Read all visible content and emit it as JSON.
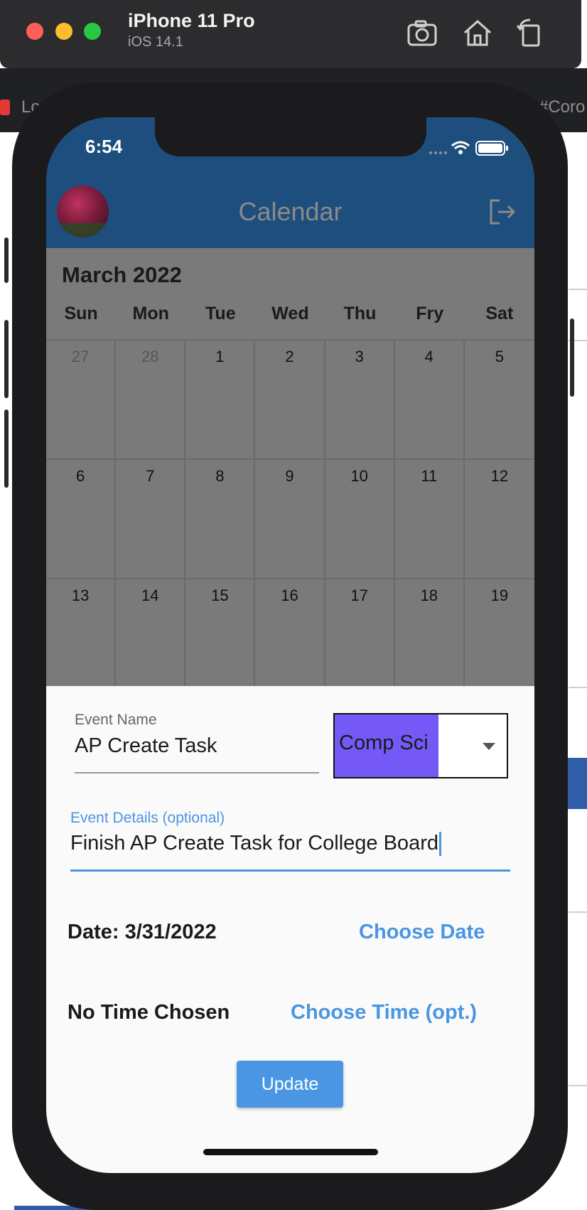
{
  "simulator": {
    "device_name": "iPhone 11 Pro",
    "os_version": "iOS 14.1",
    "buttons": [
      "screenshot-icon",
      "home-icon",
      "rotate-icon"
    ]
  },
  "background": {
    "tab_text_left": "Lo",
    "tab_text_right": "#Coro"
  },
  "status_bar": {
    "time": "6:54",
    "icons": [
      "signal-icon",
      "wifi-icon",
      "battery-icon"
    ]
  },
  "app_bar": {
    "title": "Calendar",
    "avatar": "avatar-flowers",
    "action_icon": "logout-icon"
  },
  "calendar": {
    "month_label": "March 2022",
    "weekdays": [
      "Sun",
      "Mon",
      "Tue",
      "Wed",
      "Thu",
      "Fry",
      "Sat"
    ],
    "weeks": [
      [
        "27",
        "28",
        "1",
        "2",
        "3",
        "4",
        "5"
      ],
      [
        "6",
        "7",
        "8",
        "9",
        "10",
        "11",
        "12"
      ],
      [
        "13",
        "14",
        "15",
        "16",
        "17",
        "18",
        "19"
      ]
    ]
  },
  "event_form": {
    "name_label": "Event Name",
    "name_value": "AP Create Task",
    "category_value": "Comp Sci",
    "category_color": "#7559f6",
    "details_label": "Event Details (optional)",
    "details_value": "Finish AP Create Task for College Board",
    "date_text": "Date: 3/31/2022",
    "choose_date_label": "Choose Date",
    "time_text": "No Time Chosen",
    "choose_time_label": "Choose Time (opt.)",
    "update_label": "Update"
  },
  "colors": {
    "app_bar": "#1e4e7d",
    "accent": "#4a96e2",
    "overlay_dim": "#7a7a7a"
  }
}
